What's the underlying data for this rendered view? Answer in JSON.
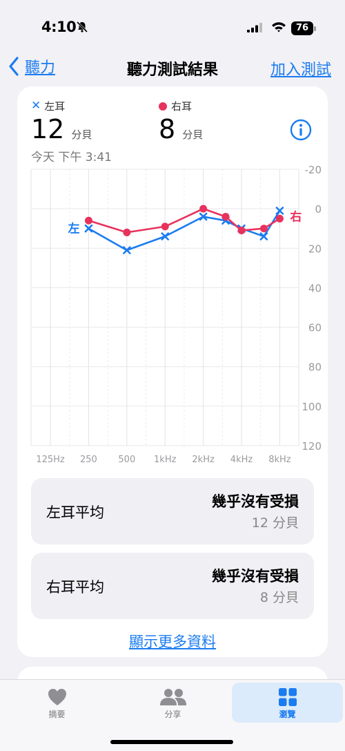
{
  "status": {
    "time": "4:10",
    "battery": "76"
  },
  "nav": {
    "back_label": "聽力",
    "title": "聽力測試結果",
    "action_label": "加入測試"
  },
  "summary": {
    "left_legend": "左耳",
    "right_legend": "右耳",
    "left_value": "12",
    "right_value": "8",
    "unit": "分貝",
    "date": "今天 下午 3:41"
  },
  "chart_data": {
    "type": "line",
    "x_ticks": [
      "125Hz",
      "250",
      "500",
      "1kHz",
      "2kHz",
      "4kHz",
      "8kHz"
    ],
    "y_ticks": [
      "-20",
      "0",
      "20",
      "40",
      "60",
      "80",
      "100",
      "120"
    ],
    "ylim": [
      -20,
      120
    ],
    "y_inverted": true,
    "series": [
      {
        "name": "左",
        "color": "#1a7cf0",
        "marker": "x",
        "x": [
          250,
          500,
          1000,
          2000,
          3000,
          4000,
          6000,
          8000
        ],
        "values": [
          10,
          21,
          14,
          4,
          6,
          10,
          14,
          1
        ]
      },
      {
        "name": "右",
        "color": "#e8325c",
        "marker": "dot",
        "x": [
          250,
          500,
          1000,
          2000,
          3000,
          4000,
          6000,
          8000
        ],
        "values": [
          6,
          12,
          9,
          0,
          4,
          11,
          10,
          5
        ]
      }
    ]
  },
  "averages": [
    {
      "label": "左耳平均",
      "status": "幾乎沒有受損",
      "value": "12 分貝"
    },
    {
      "label": "右耳平均",
      "status": "幾乎沒有受損",
      "value": "8 分貝"
    }
  ],
  "more_link": "顯示更多資料",
  "tabs": [
    {
      "label": "摘要",
      "icon": "heart-icon"
    },
    {
      "label": "分享",
      "icon": "people-icon"
    },
    {
      "label": "瀏覽",
      "icon": "grid-icon"
    }
  ],
  "colors": {
    "accent": "#1a7cf0",
    "right_ear": "#e8325c",
    "background": "#f2f1f6"
  }
}
